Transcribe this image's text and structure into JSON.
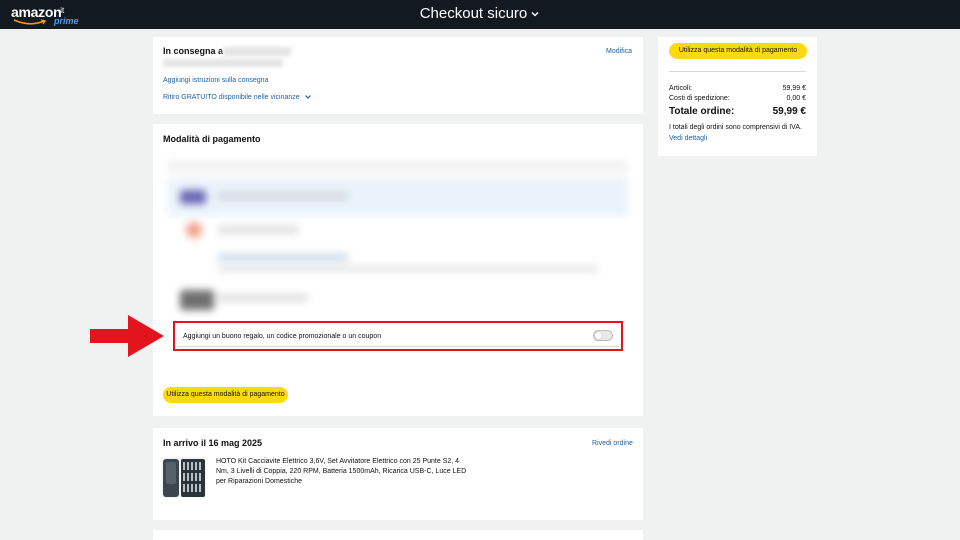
{
  "header": {
    "logo_word": "amazon",
    "logo_suffix": ".it",
    "logo_prime": "prime",
    "title": "Checkout sicuro"
  },
  "delivery": {
    "heading": "In consegna a",
    "edit_link": "Modifica",
    "instructions_link": "Aggiungi istruzioni sulla consegna",
    "pickup_link": "Ritiro GRATUITO disponibile nelle vicinanze"
  },
  "payment": {
    "heading": "Modalità di pagamento",
    "coupon_label": "Aggiungi un buono regalo, un codice promozionale o un coupon",
    "coupon_toggle_on": false,
    "use_button": "Utilizza questa modalità di pagamento"
  },
  "arrival": {
    "heading": "In arrivo il 16 mag 2025",
    "review_link": "Rivedi ordine",
    "product_title": "HOTO Kit Cacciavite Elettrico 3,6V, Set Avvitatore Elettrico con 25 Punte S2, 4 Nm, 3 Livelli di Coppia, 220 RPM, Batteria 1500mAh, Ricarica USB-C, Luce LED per Riparazioni Domestiche"
  },
  "summary": {
    "use_button": "Utilizza questa modalità di pagamento",
    "items_label": "Articoli:",
    "items_value": "59,99 €",
    "shipping_label": "Costi di spedizione:",
    "shipping_value": "0,00 €",
    "total_label": "Totale ordine:",
    "total_value": "59,99 €",
    "vat_note": "I totali degli ordini sono comprensivi di IVA.",
    "details_link": "Vedi dettagli"
  },
  "colors": {
    "header_bg": "#131921",
    "button_yellow": "#ffd814",
    "link_blue": "#2162a1",
    "highlight_red": "#e3141d",
    "page_bg": "#f0f2f2"
  },
  "icons": [
    "chevron-down-icon",
    "arrow-right-icon",
    "amazon-smile-icon"
  ]
}
